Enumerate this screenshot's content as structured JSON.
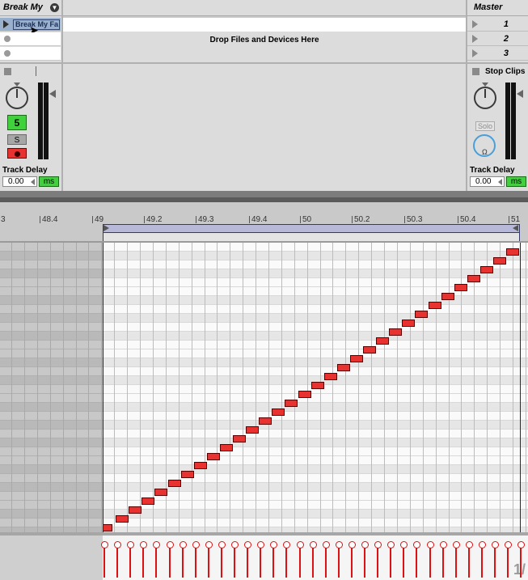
{
  "session": {
    "track_name": "Break My",
    "clip_name": "Break My Fa",
    "drop_hint": "Drop Files and Devices Here",
    "master_name": "Master",
    "scenes": [
      "1",
      "2",
      "3"
    ],
    "stop_clips": "Stop Clips",
    "solo_label": "Solo",
    "track_number": "5",
    "solo_s": "S",
    "track_delay_label": "Track Delay",
    "track_delay_value": "0.00",
    "ms_label": "ms",
    "master_delay_label": "Track Delay",
    "master_delay_value": "0.00",
    "master_ms_label": "ms"
  },
  "ruler": {
    "ticks": [
      "3",
      "48.4",
      "49",
      "49.2",
      "49.3",
      "49.4",
      "50",
      "50.2",
      "50.3",
      "50.4",
      "51"
    ]
  },
  "corner_text": "1/",
  "colors": {
    "note": "#e8322f",
    "track_number_bg": "#3fd23c",
    "ms_bg": "#3fd23c",
    "arm_bg": "#e8322f",
    "loop_bar": "#b8b8d8"
  }
}
